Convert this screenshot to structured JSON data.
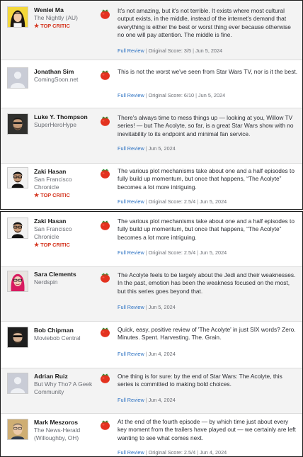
{
  "labels": {
    "full_review": "Full Review",
    "top_critic": "TOP CRITIC"
  },
  "colors": {
    "link": "#2a70c1",
    "top_critic": "#d4341e",
    "tomato": "#e3321f",
    "row_shade": "#f3f3f3"
  },
  "panel_top": [
    {
      "critic_name": "Wenlei Ma",
      "publication": "The Nightly (AU)",
      "top_critic": true,
      "avatar_icon": "critic-photo-avatar",
      "score_icon": "fresh-tomato-icon",
      "quote": "It's not amazing, but it's not terrible. It exists where most cultural output exists, in the middle, instead of the internet's demand that everything is either the best or worst thing ever because otherwise no one will pay attention. The middle is fine.",
      "original_score": "Original Score: 3/5",
      "date": "Jun 5, 2024"
    },
    {
      "critic_name": "Jonathan Sim",
      "publication": "ComingSoon.net",
      "top_critic": false,
      "avatar_icon": "placeholder-avatar",
      "score_icon": "fresh-tomato-icon",
      "quote": "This is not the worst we've seen from Star Wars TV, nor is it the best.",
      "original_score": "Original Score: 6/10",
      "date": "Jun 5, 2024"
    },
    {
      "critic_name": "Luke Y. Thompson",
      "publication": "SuperHeroHype",
      "top_critic": false,
      "avatar_icon": "critic-photo-avatar",
      "score_icon": "fresh-tomato-icon",
      "quote": "There's always time to mess things up — looking at you, Willow TV series! — but The Acolyte, so far, is a great Star Wars show with no inevitability to its endpoint and minimal fan service.",
      "original_score": "",
      "date": "Jun 5, 2024"
    },
    {
      "critic_name": "Zaki Hasan",
      "publication": "San Francisco Chronicle",
      "top_critic": true,
      "avatar_icon": "critic-photo-avatar",
      "score_icon": "fresh-tomato-icon",
      "quote": "The various plot mechanisms take about one and a half episodes to fully build up momentum, but once that happens, “The Acolyte” becomes a lot more intriguing.",
      "original_score": "Original Score: 2.5/4",
      "date": "Jun 5, 2024"
    }
  ],
  "panel_bottom": [
    {
      "critic_name": "Zaki Hasan",
      "publication": "San Francisco Chronicle",
      "top_critic": true,
      "avatar_icon": "critic-photo-avatar",
      "score_icon": "fresh-tomato-icon",
      "quote": "The various plot mechanisms take about one and a half episodes to fully build up momentum, but once that happens, “The Acolyte” becomes a lot more intriguing.",
      "original_score": "Original Score: 2.5/4",
      "date": "Jun 5, 2024"
    },
    {
      "critic_name": "Sara Clements",
      "publication": "Nerdspin",
      "top_critic": false,
      "avatar_icon": "critic-photo-avatar",
      "score_icon": "fresh-tomato-icon",
      "quote": "The Acolyte feels to be largely about the Jedi and their weaknesses. In the past, emotion has been the weakness focused on the most, but this series goes beyond that.",
      "original_score": "",
      "date": "Jun 5, 2024"
    },
    {
      "critic_name": "Bob Chipman",
      "publication": "Moviebob Central",
      "top_critic": false,
      "avatar_icon": "critic-photo-avatar",
      "score_icon": "fresh-tomato-icon",
      "quote": "Quick, easy, positive review of 'The Acolyte' in just SIX words? Zero. Minutes. Spent. Harvesting. The. Grain.",
      "original_score": "",
      "date": "Jun 4, 2024"
    },
    {
      "critic_name": "Adrian Ruiz",
      "publication": "But Why Tho? A Geek Community",
      "top_critic": false,
      "avatar_icon": "placeholder-avatar",
      "score_icon": "fresh-tomato-icon",
      "quote": "One thing is for sure: by the end of Star Wars: The Acolyte, this series is committed to making bold choices.",
      "original_score": "",
      "date": "Jun 4, 2024"
    },
    {
      "critic_name": "Mark Meszoros",
      "publication": "The News-Herald (Willoughby, OH)",
      "top_critic": false,
      "avatar_icon": "critic-photo-avatar",
      "score_icon": "fresh-tomato-icon",
      "quote": "At the end of the fourth episode — by which time just about every key moment from the trailers have played out — we certainly are left wanting to see what comes next.",
      "original_score": "Original Score: 2.5/4",
      "date": "Jun 4, 2024"
    }
  ]
}
